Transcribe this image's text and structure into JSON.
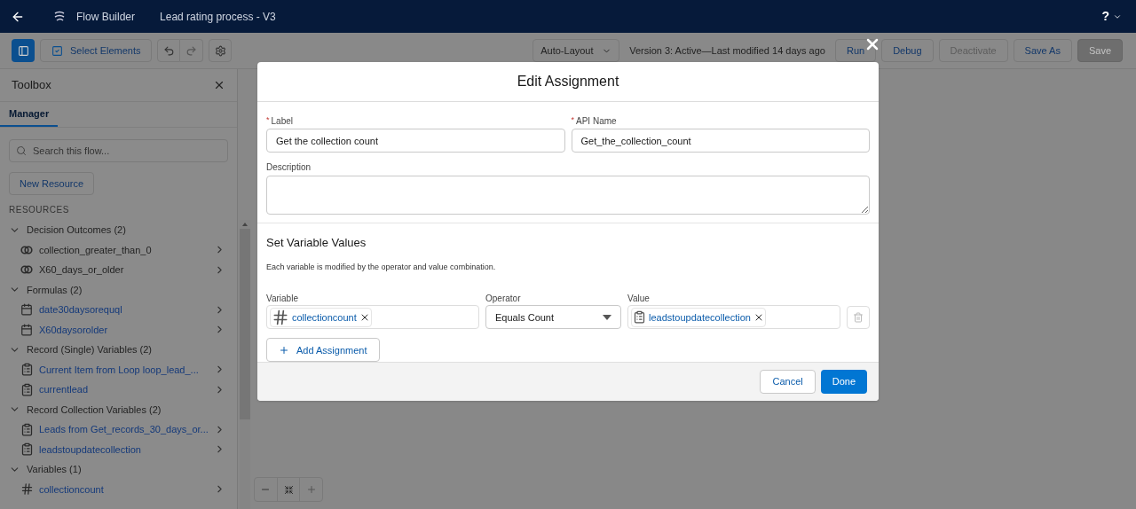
{
  "top_bar": {
    "app_title": "Flow Builder",
    "flow_name": "Lead rating process - V3",
    "help": "?"
  },
  "toolbar": {
    "select_elements": "Select Elements",
    "layout": "Auto-Layout",
    "version_status": "Version 3: Active—Last modified 14 days ago",
    "buttons": [
      {
        "label": "Run",
        "kind": "neutral",
        "disabled": false
      },
      {
        "label": "Debug",
        "kind": "neutral",
        "disabled": false
      },
      {
        "label": "Deactivate",
        "kind": "neutral",
        "disabled": true
      },
      {
        "label": "Save As",
        "kind": "neutral",
        "disabled": false
      },
      {
        "label": "Save",
        "kind": "brand",
        "disabled": true
      }
    ]
  },
  "toolbox": {
    "title": "Toolbox",
    "tabs": [
      {
        "label": "Manager",
        "selected": true
      }
    ],
    "search": {
      "placeholder": "Search this flow..."
    },
    "new_resource": "New Resource",
    "section": "RESOURCES",
    "tree": [
      {
        "label": "Decision Outcomes (2)",
        "expanded": true,
        "children": [
          {
            "label": "collection_greater_than_0",
            "kind": "outcome"
          },
          {
            "label": "X60_days_or_older",
            "kind": "outcome"
          }
        ]
      },
      {
        "label": "Formulas (2)",
        "expanded": true,
        "children": [
          {
            "label": "date30daysorequql",
            "kind": "formula"
          },
          {
            "label": "X60daysorolder",
            "kind": "formula"
          }
        ]
      },
      {
        "label": "Record (Single) Variables (2)",
        "expanded": true,
        "children": [
          {
            "label": "Current Item from Loop loop_lead_...",
            "kind": "record"
          },
          {
            "label": "currentlead",
            "kind": "record"
          }
        ]
      },
      {
        "label": "Record Collection Variables (2)",
        "expanded": true,
        "children": [
          {
            "label": "Leads from Get_records_30_days_or...",
            "kind": "record"
          },
          {
            "label": "leadstoupdatecollection",
            "kind": "record"
          }
        ]
      },
      {
        "label": "Variables (1)",
        "expanded": true,
        "children": [
          {
            "label": "collectioncount",
            "kind": "number"
          }
        ]
      }
    ]
  },
  "modal": {
    "title": "Edit Assignment",
    "label_field": {
      "label": "Label",
      "required_mark": "*",
      "value": "Get the collection count"
    },
    "api_name_field": {
      "label": "API Name",
      "required_mark": "*",
      "value": "Get_the_collection_count"
    },
    "description_field": {
      "label": "Description"
    },
    "section_title": "Set Variable Values",
    "section_hint": "Each variable is modified by the operator and value combination.",
    "assignment": {
      "variable_label": "Variable",
      "variable": {
        "value": "collectioncount",
        "kind": "number"
      },
      "operator_label": "Operator",
      "operator": "Equals Count",
      "value_label": "Value",
      "value": {
        "value": "leadstoupdatecollection",
        "kind": "record"
      }
    },
    "add_assignment": "Add Assignment",
    "cancel": "Cancel",
    "done": "Done"
  }
}
